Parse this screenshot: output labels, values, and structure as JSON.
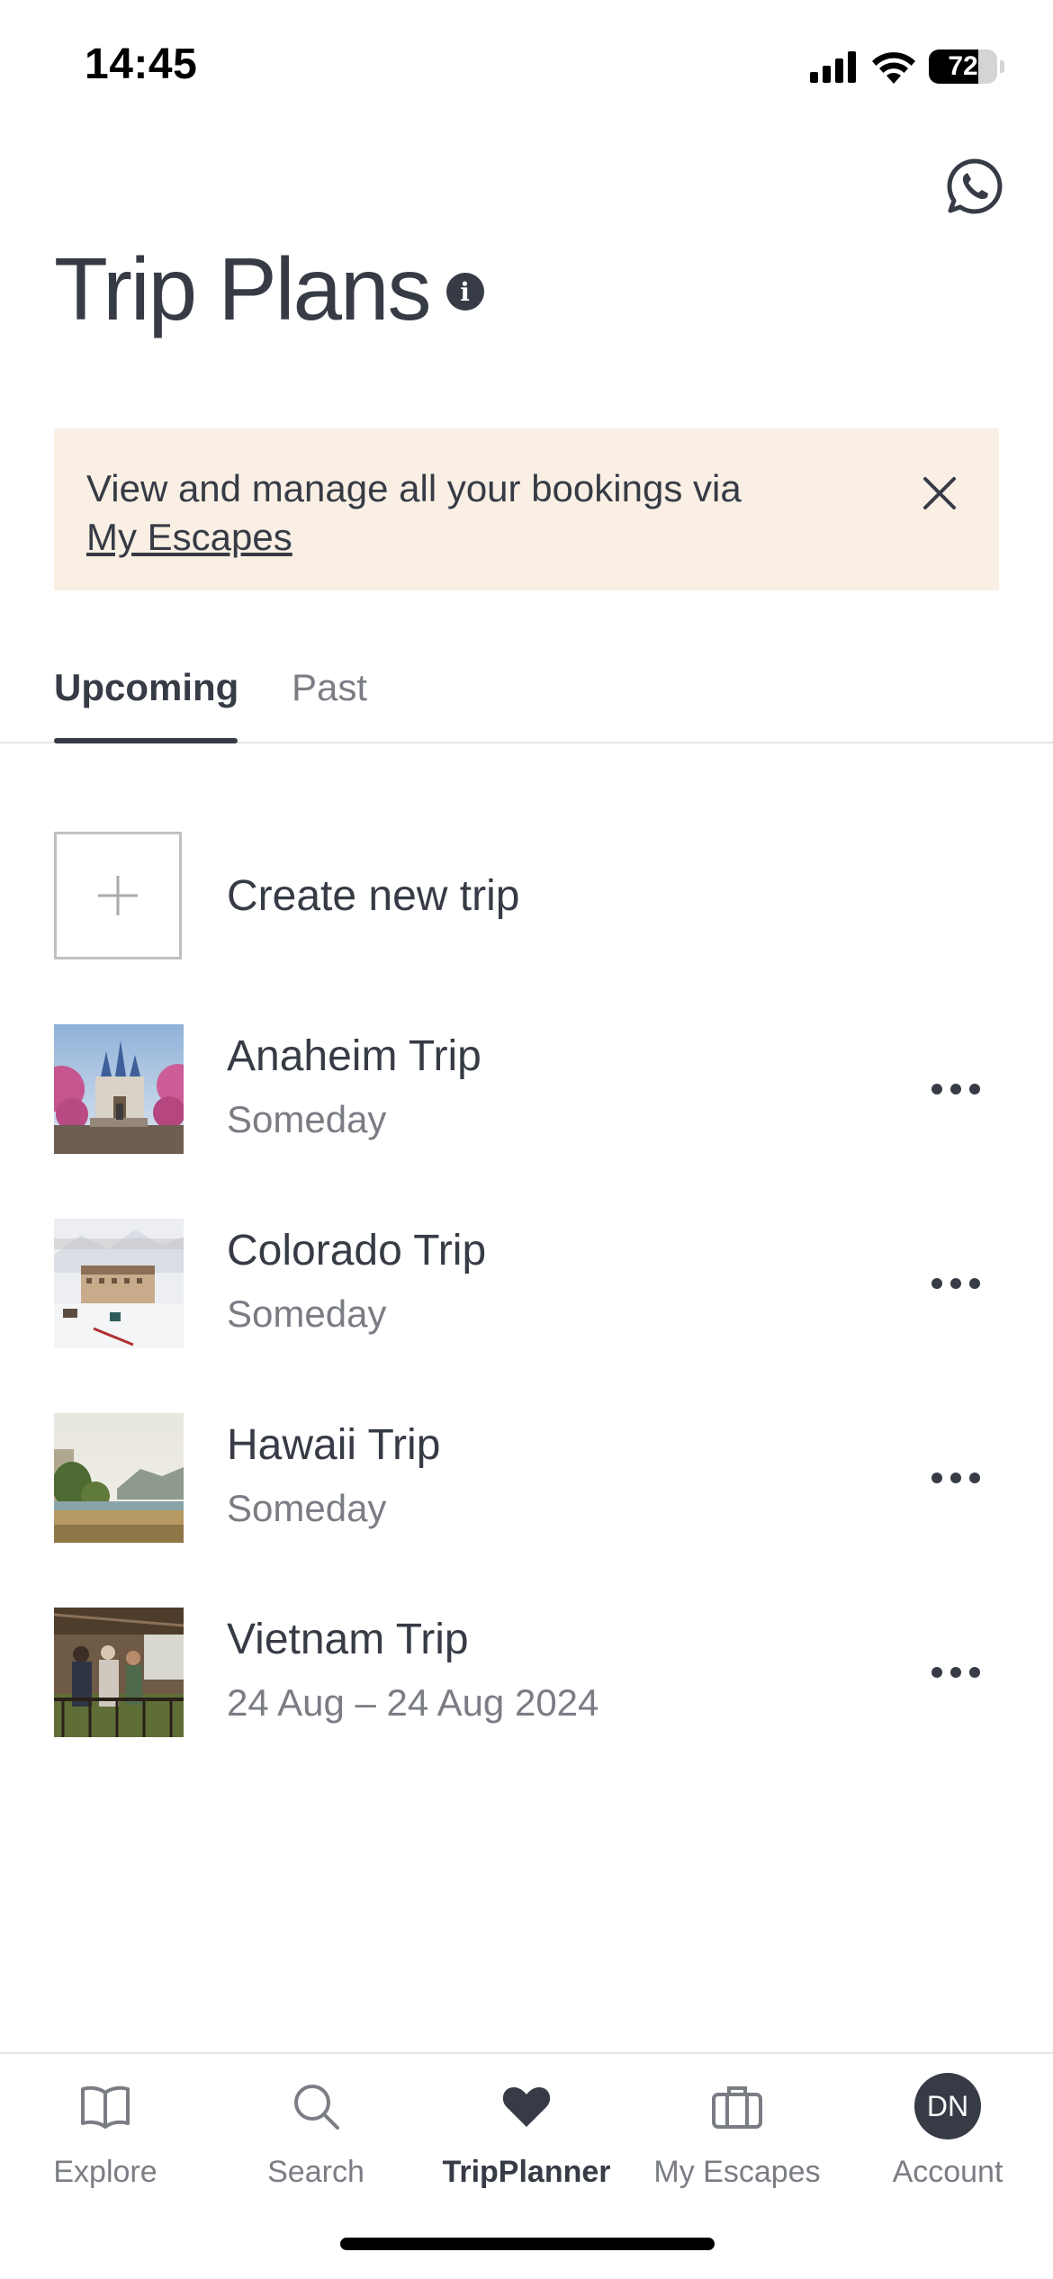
{
  "status_bar": {
    "time": "14:45",
    "battery": "72",
    "battery_level": 0.72
  },
  "header": {
    "title": "Trip Plans"
  },
  "banner": {
    "text": "View and manage all your bookings via",
    "link": "My Escapes"
  },
  "tabs": [
    {
      "label": "Upcoming",
      "selected": true
    },
    {
      "label": "Past",
      "selected": false
    }
  ],
  "create": {
    "label": "Create new trip"
  },
  "trips": [
    {
      "name": "Anaheim Trip",
      "date": "Someday"
    },
    {
      "name": "Colorado Trip",
      "date": "Someday"
    },
    {
      "name": "Hawaii Trip",
      "date": "Someday"
    },
    {
      "name": "Vietnam Trip",
      "date": "24 Aug – 24 Aug 2024"
    }
  ],
  "nav": {
    "items": [
      {
        "label": "Explore",
        "icon": "book-icon"
      },
      {
        "label": "Search",
        "icon": "search-icon"
      },
      {
        "label": "TripPlanner",
        "icon": "heart-icon",
        "active": true
      },
      {
        "label": "My Escapes",
        "icon": "suitcase-icon"
      },
      {
        "label": "Account",
        "icon": "avatar",
        "initials": "DN"
      }
    ]
  },
  "colors": {
    "text": "#363b45",
    "muted": "#7a7d83",
    "banner_bg": "#f9efe4"
  }
}
